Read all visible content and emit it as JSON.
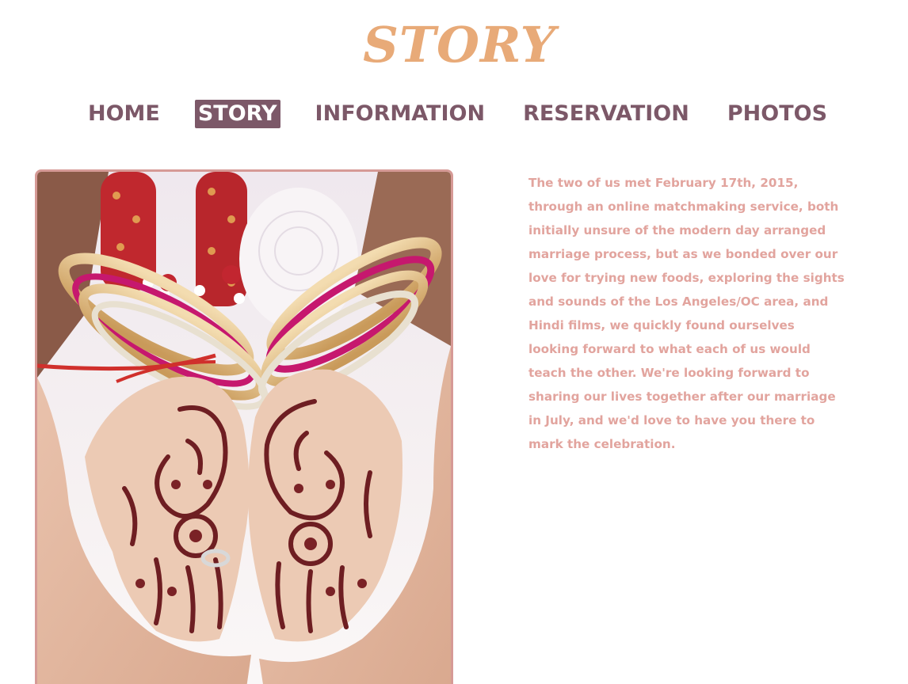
{
  "header": {
    "site_title": "STORY"
  },
  "nav": {
    "items": [
      {
        "label": "HOME",
        "active": false
      },
      {
        "label": "STORY",
        "active": true
      },
      {
        "label": "INFORMATION",
        "active": false
      },
      {
        "label": "RESERVATION",
        "active": false
      },
      {
        "label": "PHOTOS",
        "active": false
      }
    ]
  },
  "main": {
    "story_paragraph": "The two of us met February 17th, 2015, through an online matchmaking service, both initially unsure of the modern day arranged marriage process, but as we bonded over our love for trying new foods, exploring the sights and sounds of the Los Angeles/OC area, and Hindi films, we quickly found ourselves looking forward to what each of us would teach the other. We're looking forward to sharing our lives together after our marriage in July, and we'd love to have you there to mark the celebration.",
    "photo_subject": "henna-decorated hands with bangles"
  },
  "colors": {
    "title": "#e8aa78",
    "nav_text": "#7c5868",
    "nav_active_bg": "#7c5868",
    "nav_active_text": "#ffffff",
    "body_text": "#e2a49e",
    "photo_border": "#d69a96"
  }
}
